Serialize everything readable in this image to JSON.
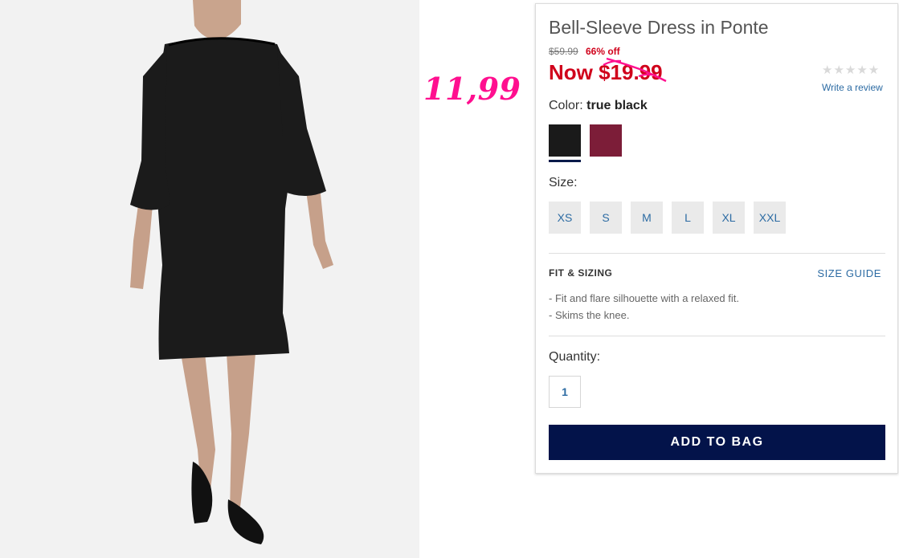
{
  "annotation": "11,99",
  "product": {
    "title": "Bell-Sleeve Dress in Ponte",
    "original_price": "$59.99",
    "discount": "66% off",
    "now_label": "Now $19.99"
  },
  "rating": {
    "stars": "★★★★★",
    "review_link": "Write a review"
  },
  "color": {
    "label": "Color:",
    "selected": "true black",
    "swatches": [
      {
        "name": "true black",
        "hex": "#1a1a1a"
      },
      {
        "name": "burgundy",
        "hex": "#7c1d38"
      }
    ]
  },
  "size": {
    "label": "Size:",
    "options": [
      "XS",
      "S",
      "M",
      "L",
      "XL",
      "XXL"
    ]
  },
  "fit": {
    "heading": "FIT & SIZING",
    "guide_link": "SIZE GUIDE",
    "bullets": [
      "- Fit and flare silhouette with a relaxed fit.",
      "- Skims the knee."
    ]
  },
  "quantity": {
    "label": "Quantity:",
    "value": "1"
  },
  "cta": {
    "add_to_bag": "ADD TO BAG"
  },
  "colors": {
    "sale_red": "#d0021b",
    "navy": "#03134a",
    "link_blue": "#2c6ba3",
    "annotation_pink": "#ff0f8f"
  }
}
